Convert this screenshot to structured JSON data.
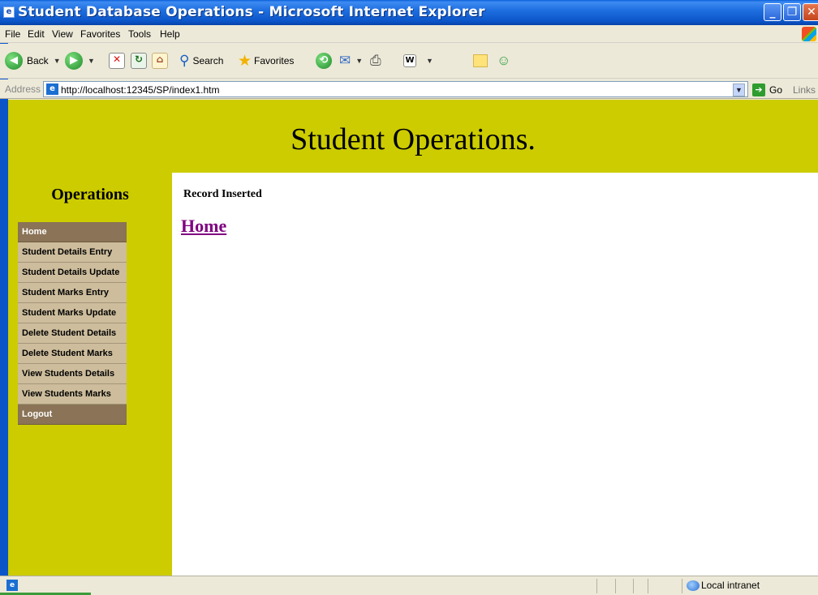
{
  "window": {
    "title": "Student Database Operations - Microsoft Internet Explorer",
    "controls": {
      "minimize": "_",
      "maximize": "❐",
      "close": "✕"
    }
  },
  "menu": [
    "File",
    "Edit",
    "View",
    "Favorites",
    "Tools",
    "Help"
  ],
  "toolbar": {
    "back_label": "Back",
    "search_label": "Search",
    "favorites_label": "Favorites"
  },
  "address": {
    "label": "Address",
    "url": "http://localhost:12345/SP/index1.htm",
    "go_label": "Go",
    "links_label": "Links"
  },
  "page": {
    "banner_title": "Student Operations.",
    "sidebar_heading": "Operations",
    "nav": [
      {
        "label": "Home",
        "style": "dark"
      },
      {
        "label": "Student Details Entry",
        "style": "light"
      },
      {
        "label": "Student Details Update",
        "style": "light"
      },
      {
        "label": "Student Marks Entry",
        "style": "light"
      },
      {
        "label": "Student Marks Update",
        "style": "light"
      },
      {
        "label": "Delete Student Details",
        "style": "light"
      },
      {
        "label": "Delete Student Marks",
        "style": "light"
      },
      {
        "label": "View Students Details",
        "style": "light"
      },
      {
        "label": "View Students Marks",
        "style": "light"
      },
      {
        "label": "Logout",
        "style": "dark"
      }
    ],
    "message": "Record Inserted",
    "home_link": "Home"
  },
  "status": {
    "zone": "Local intranet"
  },
  "colors": {
    "banner": "#cccc00",
    "nav_light": "#cdbd9c",
    "nav_dark": "#8a7356",
    "visited_link": "#800080",
    "titlebar": "#0b55c8"
  },
  "icons": [
    "ie-page-icon",
    "back-icon",
    "forward-icon",
    "stop-icon",
    "refresh-icon",
    "home-icon",
    "search-icon",
    "favorites-star-icon",
    "history-icon",
    "mail-icon",
    "print-icon",
    "edit-icon",
    "folder-icon",
    "messenger-icon",
    "go-icon",
    "local-intranet-icon",
    "windows-flag-icon"
  ]
}
